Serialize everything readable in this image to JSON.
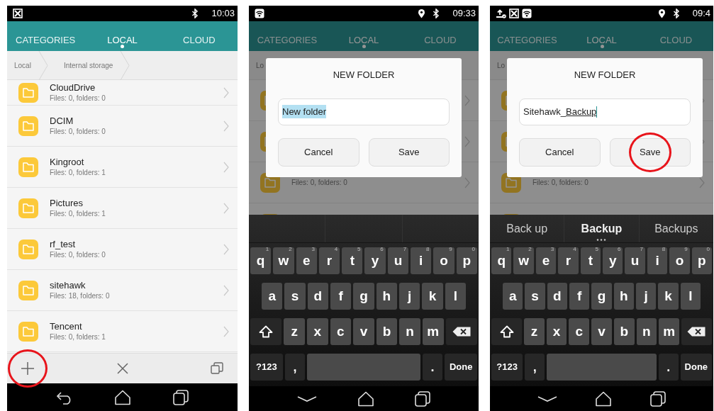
{
  "screens": [
    {
      "status_bar": {
        "left_icons": [
          {
            "kind": "notification"
          }
        ],
        "right_icons": [
          {
            "kind": "bluetooth"
          }
        ],
        "time": "10:03"
      },
      "tabs": [
        {
          "label": "CATEGORIES",
          "selected": false
        },
        {
          "label": "LOCAL",
          "selected": true
        },
        {
          "label": "CLOUD",
          "selected": false
        }
      ],
      "breadcrumb": [
        {
          "label": "Local"
        },
        {
          "label": "Internal storage"
        }
      ],
      "dimmed": false,
      "folders": [
        {
          "kind": "folder",
          "title": "CloudDrive",
          "subtitle": "Files: 0, folders: 0"
        },
        {
          "kind": "folder",
          "title": "DCIM",
          "subtitle": "Files: 0, folders: 0"
        },
        {
          "kind": "folder",
          "title": "Kingroot",
          "subtitle": "Files: 0, folders: 1"
        },
        {
          "kind": "folder",
          "title": "Pictures",
          "subtitle": "Files: 0, folders: 1"
        },
        {
          "kind": "folder",
          "title": "rf_test",
          "subtitle": "Files: 0, folders: 0"
        },
        {
          "kind": "folder",
          "title": "sitehawk",
          "subtitle": "Files: 18, folders: 0"
        },
        {
          "kind": "folder",
          "title": "Tencent",
          "subtitle": "Files: 0, folders: 1"
        }
      ],
      "toolbar": [
        {
          "kind": "add",
          "highlighted": true
        },
        {
          "kind": "close",
          "highlighted": false
        },
        {
          "kind": "copy",
          "highlighted": false
        }
      ],
      "nav_bar": [
        {
          "kind": "back"
        },
        {
          "kind": "home"
        },
        {
          "kind": "recents"
        }
      ]
    },
    {
      "status_bar": {
        "left_icons": [
          {
            "kind": "wifi"
          }
        ],
        "right_icons": [
          {
            "kind": "location"
          },
          {
            "kind": "bluetooth"
          }
        ],
        "time": "09:33"
      },
      "tabs": [
        {
          "label": "CATEGORIES",
          "selected": false
        },
        {
          "label": "LOCAL",
          "selected": true
        },
        {
          "label": "CLOUD",
          "selected": false
        }
      ],
      "breadcrumb": [
        {
          "label": "Lo"
        }
      ],
      "dimmed": true,
      "folders": [
        {
          "kind": "folder"
        },
        {
          "kind": "folder"
        },
        {
          "kind": "folder",
          "subtitle": "Files: 0, folders: 0"
        },
        {
          "kind": "folder"
        }
      ],
      "dialog": {
        "title": "NEW FOLDER",
        "field": {
          "segments": [
            {
              "text": "New folder",
              "kind": "selected"
            }
          ],
          "cursor": false
        },
        "buttons": [
          {
            "label": "Cancel",
            "highlighted": false
          },
          {
            "label": "Save",
            "highlighted": false
          }
        ]
      },
      "keyboard": {
        "rows": [
          {
            "keys": [
              {
                "kind": "letter",
                "label": "q",
                "hint": "1"
              },
              {
                "kind": "letter",
                "label": "w",
                "hint": "2"
              },
              {
                "kind": "letter",
                "label": "e",
                "hint": "3"
              },
              {
                "kind": "letter",
                "label": "r",
                "hint": "4"
              },
              {
                "kind": "letter",
                "label": "t",
                "hint": "5"
              },
              {
                "kind": "letter",
                "label": "y",
                "hint": "6"
              },
              {
                "kind": "letter",
                "label": "u",
                "hint": "7"
              },
              {
                "kind": "letter",
                "label": "i",
                "hint": "8"
              },
              {
                "kind": "letter",
                "label": "o",
                "hint": "9"
              },
              {
                "kind": "letter",
                "label": "p",
                "hint": "0"
              }
            ]
          },
          {
            "keys": [
              {
                "kind": "letter",
                "label": "a"
              },
              {
                "kind": "letter",
                "label": "s"
              },
              {
                "kind": "letter",
                "label": "d"
              },
              {
                "kind": "letter",
                "label": "f"
              },
              {
                "kind": "letter",
                "label": "g"
              },
              {
                "kind": "letter",
                "label": "h"
              },
              {
                "kind": "letter",
                "label": "j"
              },
              {
                "kind": "letter",
                "label": "k"
              },
              {
                "kind": "letter",
                "label": "l"
              }
            ]
          },
          {
            "keys": [
              {
                "kind": "shift"
              },
              {
                "kind": "letter",
                "label": "z"
              },
              {
                "kind": "letter",
                "label": "x"
              },
              {
                "kind": "letter",
                "label": "c"
              },
              {
                "kind": "letter",
                "label": "v"
              },
              {
                "kind": "letter",
                "label": "b"
              },
              {
                "kind": "letter",
                "label": "n"
              },
              {
                "kind": "letter",
                "label": "m"
              },
              {
                "kind": "backspace"
              }
            ]
          },
          {
            "keys": [
              {
                "kind": "function",
                "label": "?123"
              },
              {
                "kind": "punct",
                "label": ","
              },
              {
                "kind": "space"
              },
              {
                "kind": "punct",
                "label": "."
              },
              {
                "kind": "function",
                "label": "Done"
              }
            ]
          }
        ]
      },
      "nav_bar": [
        {
          "kind": "hide-keyboard"
        },
        {
          "kind": "home"
        },
        {
          "kind": "recents"
        }
      ]
    },
    {
      "status_bar": {
        "left_icons": [
          {
            "kind": "upload"
          },
          {
            "kind": "notification"
          },
          {
            "kind": "wifi"
          }
        ],
        "right_icons": [
          {
            "kind": "location"
          },
          {
            "kind": "bluetooth"
          }
        ],
        "time": "09:4"
      },
      "tabs": [
        {
          "label": "CATEGORIES",
          "selected": false
        },
        {
          "label": "LOCAL",
          "selected": true
        },
        {
          "label": "CLOUD",
          "selected": false
        }
      ],
      "breadcrumb": [
        {
          "label": "Lo"
        }
      ],
      "dimmed": true,
      "folders": [
        {
          "kind": "folder"
        },
        {
          "kind": "folder"
        },
        {
          "kind": "folder",
          "subtitle": "Files: 0, folders: 0"
        },
        {
          "kind": "folder"
        }
      ],
      "dialog": {
        "title": "NEW FOLDER",
        "field": {
          "segments": [
            {
              "text": "Sitehawk_",
              "kind": "plain"
            },
            {
              "text": "Backup",
              "kind": "composing"
            }
          ],
          "cursor": true
        },
        "buttons": [
          {
            "label": "Cancel",
            "highlighted": false
          },
          {
            "label": "Save",
            "highlighted": true
          }
        ]
      },
      "keyboard": {
        "suggestions": [
          {
            "text": "Back up",
            "selected": false
          },
          {
            "text": "Backup",
            "selected": true
          },
          {
            "text": "Backups",
            "selected": false
          }
        ],
        "rows": [
          {
            "keys": [
              {
                "kind": "letter",
                "label": "q",
                "hint": "1"
              },
              {
                "kind": "letter",
                "label": "w",
                "hint": "2"
              },
              {
                "kind": "letter",
                "label": "e",
                "hint": "3"
              },
              {
                "kind": "letter",
                "label": "r",
                "hint": "4"
              },
              {
                "kind": "letter",
                "label": "t",
                "hint": "5"
              },
              {
                "kind": "letter",
                "label": "y",
                "hint": "6"
              },
              {
                "kind": "letter",
                "label": "u",
                "hint": "7"
              },
              {
                "kind": "letter",
                "label": "i",
                "hint": "8"
              },
              {
                "kind": "letter",
                "label": "o",
                "hint": "9"
              },
              {
                "kind": "letter",
                "label": "p",
                "hint": "0"
              }
            ]
          },
          {
            "keys": [
              {
                "kind": "letter",
                "label": "a"
              },
              {
                "kind": "letter",
                "label": "s"
              },
              {
                "kind": "letter",
                "label": "d"
              },
              {
                "kind": "letter",
                "label": "f"
              },
              {
                "kind": "letter",
                "label": "g"
              },
              {
                "kind": "letter",
                "label": "h"
              },
              {
                "kind": "letter",
                "label": "j"
              },
              {
                "kind": "letter",
                "label": "k"
              },
              {
                "kind": "letter",
                "label": "l"
              }
            ]
          },
          {
            "keys": [
              {
                "kind": "shift"
              },
              {
                "kind": "letter",
                "label": "z"
              },
              {
                "kind": "letter",
                "label": "x"
              },
              {
                "kind": "letter",
                "label": "c"
              },
              {
                "kind": "letter",
                "label": "v"
              },
              {
                "kind": "letter",
                "label": "b"
              },
              {
                "kind": "letter",
                "label": "n"
              },
              {
                "kind": "letter",
                "label": "m"
              },
              {
                "kind": "backspace"
              }
            ]
          },
          {
            "keys": [
              {
                "kind": "function",
                "label": "?123"
              },
              {
                "kind": "punct",
                "label": ","
              },
              {
                "kind": "space"
              },
              {
                "kind": "punct",
                "label": "."
              },
              {
                "kind": "function",
                "label": "Done"
              }
            ]
          }
        ]
      },
      "nav_bar": [
        {
          "kind": "hide-keyboard"
        },
        {
          "kind": "home"
        },
        {
          "kind": "recents"
        }
      ]
    }
  ]
}
